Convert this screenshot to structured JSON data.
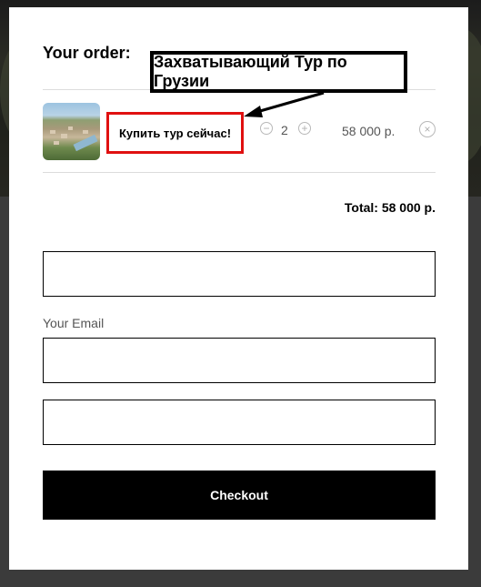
{
  "order": {
    "title": "Your order:",
    "item": {
      "name": "Купить тур сейчас!",
      "quantity": "2",
      "price": "58 000 р.",
      "minus_symbol": "−",
      "plus_symbol": "+",
      "remove_symbol": "×"
    },
    "total": "Total: 58 000 р."
  },
  "form": {
    "email_label": "Your Email",
    "checkout_label": "Checkout"
  },
  "annotation": {
    "callout_text": "Захватывающий Тур по Грузии",
    "highlight_color": "#e01010"
  }
}
